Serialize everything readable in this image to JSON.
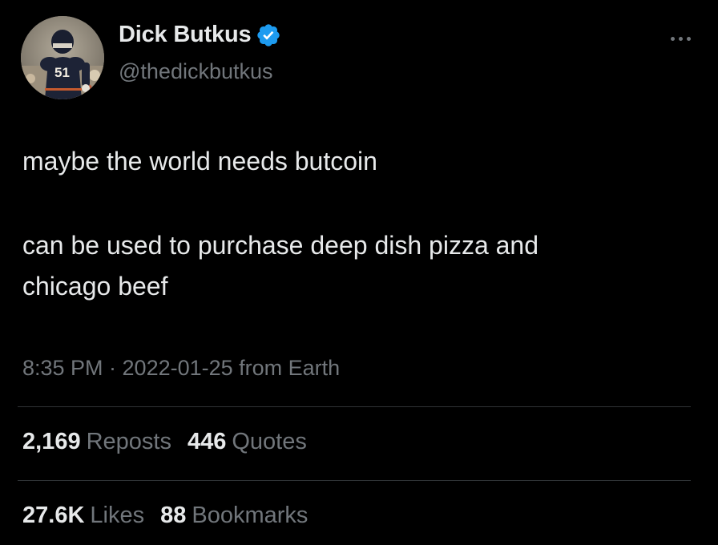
{
  "author": {
    "display_name": "Dick Butkus",
    "handle": "@thedickbutkus",
    "verified": true,
    "verified_color": "#1d9bf0",
    "avatar_icon": "player-photo-avatar"
  },
  "tweet": {
    "lines": [
      "maybe the world needs butcoin",
      "can be used to purchase deep dish pizza and",
      "chicago beef"
    ],
    "timestamp": "8:35 PM · 2022-01-25 from Earth"
  },
  "stats": {
    "reposts_count": "2,169",
    "reposts_label": "Reposts",
    "quotes_count": "446",
    "quotes_label": "Quotes",
    "likes_count": "27.6K",
    "likes_label": "Likes",
    "bookmarks_count": "88",
    "bookmarks_label": "Bookmarks"
  },
  "colors": {
    "background": "#000000",
    "primary_text": "#e7e9ea",
    "secondary_text": "#71767b",
    "divider": "#2f3336"
  }
}
